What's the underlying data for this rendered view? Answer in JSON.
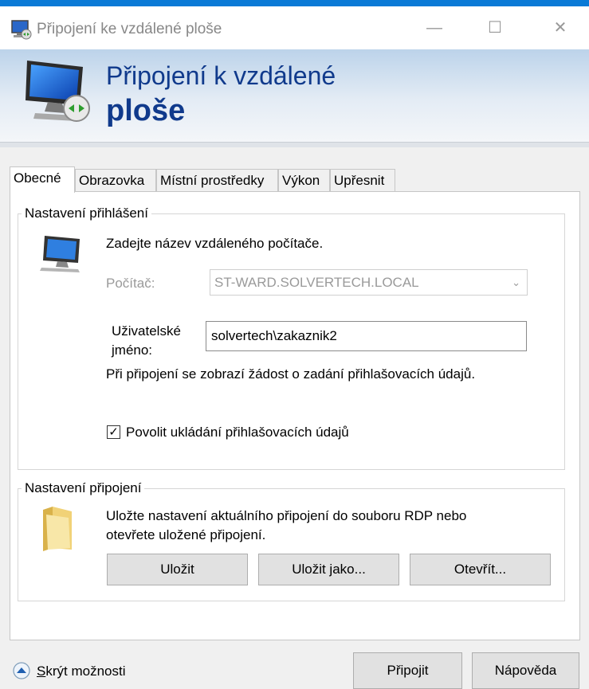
{
  "window": {
    "title": "Připojení ke vzdálené ploše",
    "minimize_glyph": "—",
    "maximize_glyph": "☐",
    "close_glyph": "✕"
  },
  "banner": {
    "title_line1": "Připojení k vzdálené",
    "title_line2": "ploše"
  },
  "tabs": [
    {
      "label": "Obecné",
      "active": true
    },
    {
      "label": "Obrazovka",
      "active": false
    },
    {
      "label": "Místní prostředky",
      "active": false
    },
    {
      "label": "Výkon",
      "active": false
    },
    {
      "label": "Upřesnit",
      "active": false
    }
  ],
  "login_group": {
    "legend": "Nastavení přihlášení",
    "instruction": "Zadejte název vzdáleného počítače.",
    "computer_label": "Počítač:",
    "computer_value": "ST-WARD.SOLVERTECH.LOCAL",
    "username_label_line1": "Uživatelské",
    "username_label_line2": "jméno:",
    "username_value": "solvertech\\zakaznik2",
    "credentials_note": "Při připojení se zobrazí žádost o zadání přihlašovacích údajů.",
    "save_credentials_label": "Povolit ukládání přihlašovacích údajů",
    "save_credentials_checked": true
  },
  "connection_group": {
    "legend": "Nastavení připojení",
    "description_line1": "Uložte nastavení aktuálního připojení do souboru RDP nebo",
    "description_line2": "otevřete uložené připojení.",
    "save_label": "Uložit",
    "save_as_label": "Uložit jako...",
    "open_label": "Otevřít..."
  },
  "footer": {
    "hide_options_first_letter": "S",
    "hide_options_rest": "krýt možnosti",
    "connect_label": "Připojit",
    "help_label": "Nápověda"
  },
  "colors": {
    "accent": "#0a7ad6",
    "banner_title": "#103a8c"
  }
}
